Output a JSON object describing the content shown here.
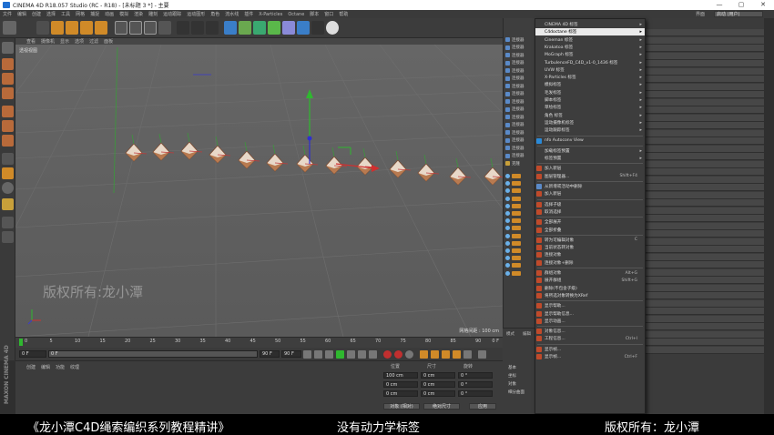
{
  "window": {
    "title": "CINEMA 4D R18.057 Studio (RC - R18) - [未标题 3 *] - 主要",
    "controls": [
      "—",
      "▢",
      "✕"
    ]
  },
  "menubar": {
    "items": [
      "文件",
      "编辑",
      "创建",
      "选择",
      "工具",
      "网格",
      "捕捉",
      "动画",
      "模拟",
      "渲染",
      "雕刻",
      "运动跟踪",
      "运动图形",
      "角色",
      "流水线",
      "插件",
      "X-Particles",
      "Octane",
      "脚本",
      "窗口",
      "帮助"
    ],
    "layout_label": "界面",
    "layout_value": "启动 (用户)"
  },
  "viewport": {
    "menu": [
      "查看",
      "摄像机",
      "显示",
      "选项",
      "过滤",
      "面板"
    ],
    "label": "透视视图",
    "grid_readout": "网格间距 : 100 cm",
    "watermark": "版权所有:龙小潭"
  },
  "timeline": {
    "ticks": [
      "0",
      "5",
      "10",
      "15",
      "20",
      "25",
      "30",
      "35",
      "40",
      "45",
      "50",
      "55",
      "60",
      "65",
      "70",
      "75",
      "80",
      "85",
      "90"
    ],
    "end_label": "0 F"
  },
  "playback": {
    "start": "0 F",
    "current": "0 F",
    "end": "90 F",
    "end2": "90 F"
  },
  "material_panel": {
    "menu": [
      "创建",
      "编辑",
      "功能",
      "纹理"
    ]
  },
  "maxon": {
    "logo": "MAXON CINEMA 4D"
  },
  "coords": {
    "headers": [
      "位置",
      "尺寸",
      "旋转"
    ],
    "rows": [
      [
        "X",
        "100 cm",
        "X",
        "0 cm",
        "H",
        "0 °"
      ],
      [
        "Y",
        "0 cm",
        "Y",
        "0 cm",
        "P",
        "0 °"
      ],
      [
        "Z",
        "0 cm",
        "Z",
        "0 cm",
        "B",
        "0 °"
      ]
    ],
    "mode": "对象 (相对)",
    "size_mode": "绝对尺寸",
    "apply": "应用"
  },
  "object_rows": [
    "连接器",
    "连接器",
    "连接器",
    "连接器",
    "连接器",
    "连接器",
    "连接器",
    "连接器",
    "连接器",
    "连接器",
    "连接器",
    "连接器",
    "连接器",
    "连接器",
    "连接器",
    "连接器",
    "克隆"
  ],
  "menu": {
    "items": [
      {
        "label": "CINEMA 4D 标签",
        "arrow": true
      },
      {
        "label": "C4doctane 标签",
        "arrow": true,
        "highlight": true
      },
      {
        "label": "Cineman 标签",
        "arrow": true
      },
      {
        "label": "Krakatoa 标签",
        "arrow": true
      },
      {
        "label": "MoGraph 标签",
        "arrow": true
      },
      {
        "label": "TurbulenceFD_C4D_v1-0_1436 标签",
        "arrow": true
      },
      {
        "label": "UVW 标签",
        "arrow": true
      },
      {
        "label": "X-Particles 标签",
        "arrow": true
      },
      {
        "label": "模拟标签",
        "arrow": true
      },
      {
        "label": "毛发标签",
        "arrow": true
      },
      {
        "label": "脚本标签",
        "arrow": true
      },
      {
        "label": "草绘标签",
        "arrow": true
      },
      {
        "label": "角色 标签",
        "arrow": true
      },
      {
        "label": "运动摄像机标签",
        "arrow": true
      },
      {
        "label": "运动跟踪标签",
        "arrow": true
      },
      {
        "sep": true
      },
      {
        "label": "nfo Autoconv View",
        "icon": "#2a8ad8"
      },
      {
        "sep": true
      },
      {
        "label": "加载标签预置",
        "arrow": true
      },
      {
        "label": "标签预置",
        "arrow": true
      },
      {
        "sep": true
      },
      {
        "label": "加入新层",
        "icon": "#c04a2a"
      },
      {
        "label": "图层管理器...",
        "icon": "#c04a2a",
        "shortcut": "Shift+F4"
      },
      {
        "sep": true
      },
      {
        "label": "从新增或活动中删除",
        "icon": "#5a8ac8"
      },
      {
        "label": "加入新层",
        "icon": "#c04a2a"
      },
      {
        "sep": true
      },
      {
        "label": "选择子级",
        "icon": "#c04a2a"
      },
      {
        "label": "取消选择",
        "icon": "#c04a2a"
      },
      {
        "sep": true
      },
      {
        "label": "全部展开",
        "icon": "#c04a2a"
      },
      {
        "label": "全部折叠",
        "icon": "#c04a2a"
      },
      {
        "sep": true
      },
      {
        "label": "转为可编辑对象",
        "icon": "#c04a2a",
        "shortcut": "C"
      },
      {
        "label": "当前状态转对象",
        "icon": "#c04a2a"
      },
      {
        "label": "连接对象",
        "icon": "#c04a2a"
      },
      {
        "label": "连接对象+删除",
        "icon": "#c04a2a"
      },
      {
        "sep": true
      },
      {
        "label": "群组对象",
        "icon": "#c04a2a",
        "shortcut": "Alt+G"
      },
      {
        "label": "展开群组",
        "icon": "#c04a2a",
        "shortcut": "Shift+G"
      },
      {
        "label": "删除(不包含子级)",
        "icon": "#c04a2a"
      },
      {
        "label": "将所选对象转换为XRef",
        "icon": "#c04a2a"
      },
      {
        "sep": true
      },
      {
        "label": "显示帮助...",
        "icon": "#c04a2a"
      },
      {
        "label": "显示帮助信息...",
        "icon": "#c04a2a"
      },
      {
        "label": "显示动画...",
        "icon": "#c04a2a"
      },
      {
        "sep": true
      },
      {
        "label": "对象信息...",
        "icon": "#c04a2a"
      },
      {
        "label": "工程信息...",
        "icon": "#c04a2a",
        "shortcut": "Ctrl+I"
      },
      {
        "sep": true
      },
      {
        "label": "显示帧...",
        "icon": "#c04a2a"
      },
      {
        "label": "显示帧...",
        "icon": "#c04a2a",
        "shortcut": "Ctrl+F"
      }
    ]
  },
  "attr_panel": {
    "items": [
      "模式",
      "编辑",
      "用户数据"
    ],
    "tabs": [
      "基本",
      "坐标",
      "对象",
      "细分曲面"
    ]
  },
  "caption": {
    "left": "《龙小潭C4D绳索编织系列教程精讲》",
    "center": "没有动力学标签",
    "right": "版权所有：龙小潭"
  }
}
